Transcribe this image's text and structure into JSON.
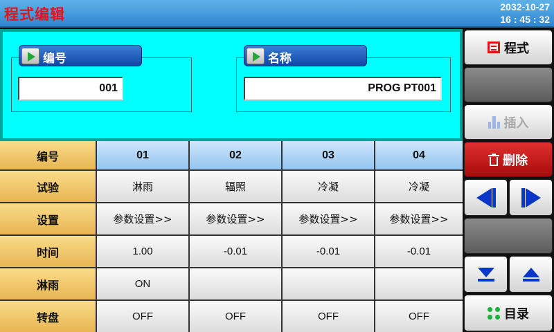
{
  "header": {
    "title": "程式编辑",
    "date": "2032-10-27",
    "time": "16 : 45 : 32"
  },
  "program": {
    "number_label": "编号",
    "number_value": "001",
    "name_label": "名称",
    "name_value": "PROG PT001"
  },
  "table": {
    "row_headers": [
      "编号",
      "试验",
      "设置",
      "时间",
      "淋雨",
      "转盘"
    ],
    "columns": [
      "01",
      "02",
      "03",
      "04"
    ],
    "rows": [
      [
        "淋雨",
        "辐照",
        "冷凝",
        "冷凝"
      ],
      [
        "参数设置>>",
        "参数设置>>",
        "参数设置>>",
        "参数设置>>"
      ],
      [
        "1.00",
        "-0.01",
        "-0.01",
        "-0.01"
      ],
      [
        "ON",
        "",
        "",
        ""
      ],
      [
        "OFF",
        "OFF",
        "OFF",
        "OFF"
      ]
    ]
  },
  "sidebar": {
    "program_label": "程式",
    "insert_label": "插入",
    "delete_label": "删除",
    "catalog_label": "目录"
  },
  "colors": {
    "accent_red": "#e0141b",
    "nav_blue": "#0a37c8",
    "panel_cyan": "#00ffff",
    "delete_red": "#c41a1a"
  },
  "icons": [
    "arrow-right-icon",
    "program-icon",
    "insert-icon",
    "trash-icon",
    "prev-icon",
    "next-icon",
    "down-icon",
    "up-icon",
    "catalog-icon"
  ]
}
